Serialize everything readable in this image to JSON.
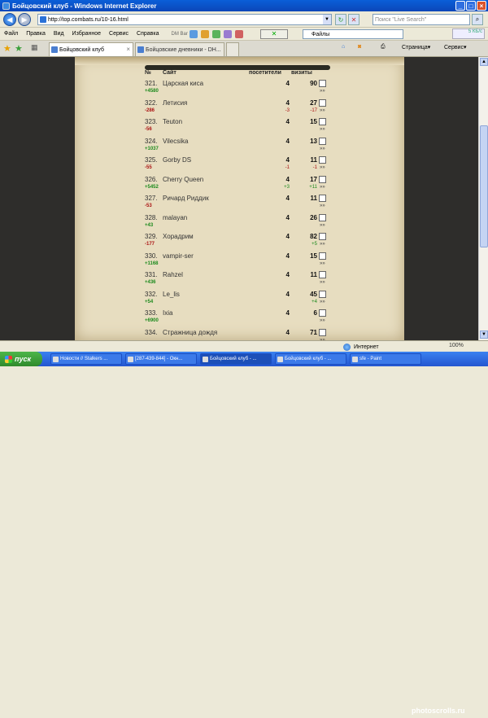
{
  "window": {
    "title": "Бойцовский клуб - Windows Internet Explorer"
  },
  "address": {
    "url": "http://top.combats.ru/10-16.html"
  },
  "search": {
    "placeholder": "Поиск \"Live Search\""
  },
  "menu": [
    "Файл",
    "Правка",
    "Вид",
    "Избранное",
    "Сервис",
    "Справка"
  ],
  "toolbar": {
    "dm_bar": "DM Bar",
    "files_label": "Файлы",
    "kb_label": "5 КБ/с"
  },
  "tabs": [
    {
      "label": "Бойцовский клуб",
      "active": true
    },
    {
      "label": "Бойцовские дневники - DH...",
      "active": false
    }
  ],
  "right_tools": {
    "page": "Страница",
    "service": "Сервис"
  },
  "table": {
    "headers": {
      "num": "№",
      "site": "Сайт",
      "visitors": "посетители",
      "visits": "визиты"
    },
    "more": "»»",
    "rows": [
      {
        "rank": "321.",
        "site": "Царская киса",
        "visitors": "4",
        "visits": "90",
        "delta": "+4580",
        "dir": "up",
        "dv": "",
        "dvs": ""
      },
      {
        "rank": "322.",
        "site": "Летисия",
        "visitors": "4",
        "visits": "27",
        "delta": "-286",
        "dir": "dn",
        "dv": "-3",
        "dvs": "-17"
      },
      {
        "rank": "323.",
        "site": "Teuton",
        "visitors": "4",
        "visits": "15",
        "delta": "-56",
        "dir": "dn",
        "dv": "",
        "dvs": ""
      },
      {
        "rank": "324.",
        "site": "Vilecsika",
        "visitors": "4",
        "visits": "13",
        "delta": "+1037",
        "dir": "up",
        "dv": "",
        "dvs": ""
      },
      {
        "rank": "325.",
        "site": "Gorby DS",
        "visitors": "4",
        "visits": "11",
        "delta": "-55",
        "dir": "dn",
        "dv": "-1",
        "dvs": "-1"
      },
      {
        "rank": "326.",
        "site": "Cherry Queen",
        "visitors": "4",
        "visits": "17",
        "delta": "+5452",
        "dir": "up",
        "dv": "+3",
        "dvs": "+11"
      },
      {
        "rank": "327.",
        "site": "Ричард Риддик",
        "visitors": "4",
        "visits": "11",
        "delta": "-53",
        "dir": "dn",
        "dv": "",
        "dvs": ""
      },
      {
        "rank": "328.",
        "site": "malayan",
        "visitors": "4",
        "visits": "26",
        "delta": "+43",
        "dir": "up",
        "dv": "",
        "dvs": ""
      },
      {
        "rank": "329.",
        "site": "Хорадрим",
        "visitors": "4",
        "visits": "82",
        "delta": "-177",
        "dir": "dn",
        "dv": "",
        "dvs": "+5"
      },
      {
        "rank": "330.",
        "site": "vampir-ser",
        "visitors": "4",
        "visits": "15",
        "delta": "+1168",
        "dir": "up",
        "dv": "",
        "dvs": ""
      },
      {
        "rank": "331.",
        "site": "Rahzel",
        "visitors": "4",
        "visits": "11",
        "delta": "+436",
        "dir": "up",
        "dv": "",
        "dvs": ""
      },
      {
        "rank": "332.",
        "site": "Le_lis",
        "visitors": "4",
        "visits": "45",
        "delta": "+54",
        "dir": "up",
        "dv": "",
        "dvs": "+4"
      },
      {
        "rank": "333.",
        "site": "Ixia",
        "visitors": "4",
        "visits": "6",
        "delta": "+6900",
        "dir": "up",
        "dv": "",
        "dvs": ""
      },
      {
        "rank": "334.",
        "site": "Стражница дождя",
        "visitors": "4",
        "visits": "71",
        "delta": "",
        "dir": "up",
        "dv": "",
        "dvs": ""
      }
    ]
  },
  "status": {
    "zone": "Интернет",
    "zoom": "100%"
  },
  "taskbar": {
    "start": "пуск",
    "tasks": [
      {
        "label": "Новости // Stalkers ...",
        "active": false
      },
      {
        "label": "[287-439-844] - Окн...",
        "active": false
      },
      {
        "label": "Бойцовский клуб - ...",
        "active": true
      },
      {
        "label": "Бойцовский клуб - ...",
        "active": false
      },
      {
        "label": "sfe - Paint",
        "active": false
      }
    ]
  },
  "watermark": "photoscrolls.ru",
  "colors": {
    "up": "#1c8a1c",
    "down": "#a11",
    "parchment": "#e7ddc0",
    "titlebar": "#0a5fd8"
  }
}
